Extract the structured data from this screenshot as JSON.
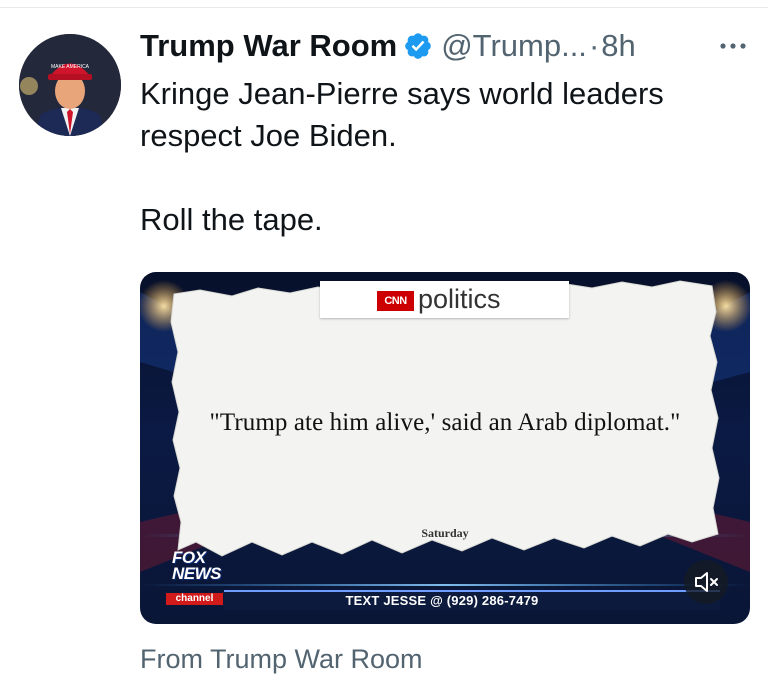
{
  "tweet": {
    "display_name": "Trump War Room",
    "handle": "@Trump...",
    "separator": "·",
    "time": "8h",
    "more_icon": "more-horizontal-icon",
    "verified_color": "#1d9bf0",
    "text_line1": "Kringe Jean-Pierre says world leaders",
    "text_line2": "respect Joe Biden.",
    "text_line3": "Roll the tape."
  },
  "media": {
    "cnn_logo": "CNN",
    "cnn_section": "politics",
    "quote": "\"Trump ate him alive,' said an Arab diplomat.\"",
    "dateline": "Saturday",
    "fox_line1": "FOX",
    "fox_line2": "NEWS",
    "fox_line3": "channel",
    "ticker": "TEXT JESSE @ (929) 286-7479",
    "mute_icon": "speaker-muted-icon"
  },
  "footer": {
    "from_label": "From Trump War Room"
  },
  "colors": {
    "accent": "#1d9bf0",
    "text_primary": "#0f1419",
    "text_secondary": "#536471",
    "cnn_red": "#cc0000",
    "fox_red": "#d11a1a"
  }
}
